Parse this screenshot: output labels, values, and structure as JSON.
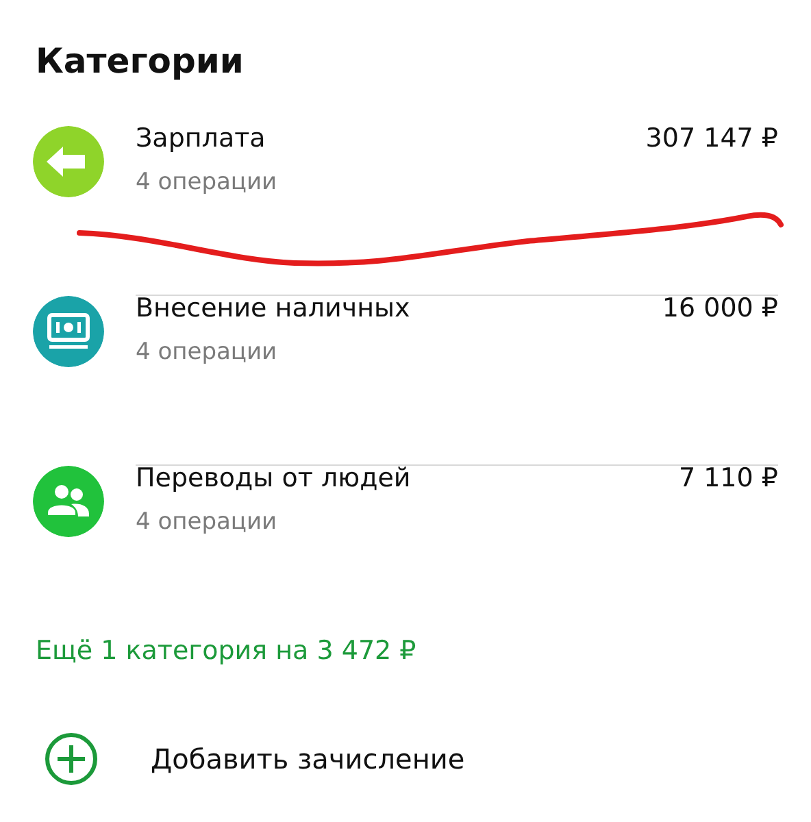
{
  "title": "Категории",
  "categories": [
    {
      "name": "Зарплата",
      "subtitle": "4 операции",
      "amount": "307 147 ₽",
      "kind": "arrow",
      "color": "#8fd42a"
    },
    {
      "name": "Внесение наличных",
      "subtitle": "4 операции",
      "amount": "16 000 ₽",
      "kind": "cash",
      "color": "#1aa3a8"
    },
    {
      "name": "Переводы от людей",
      "subtitle": "4 операции",
      "amount": "7 110 ₽",
      "kind": "people",
      "color": "#21c23c"
    }
  ],
  "more_link": "Ещё 1 категория на 3 472 ₽",
  "add_action": {
    "label": "Добавить зачисление"
  }
}
